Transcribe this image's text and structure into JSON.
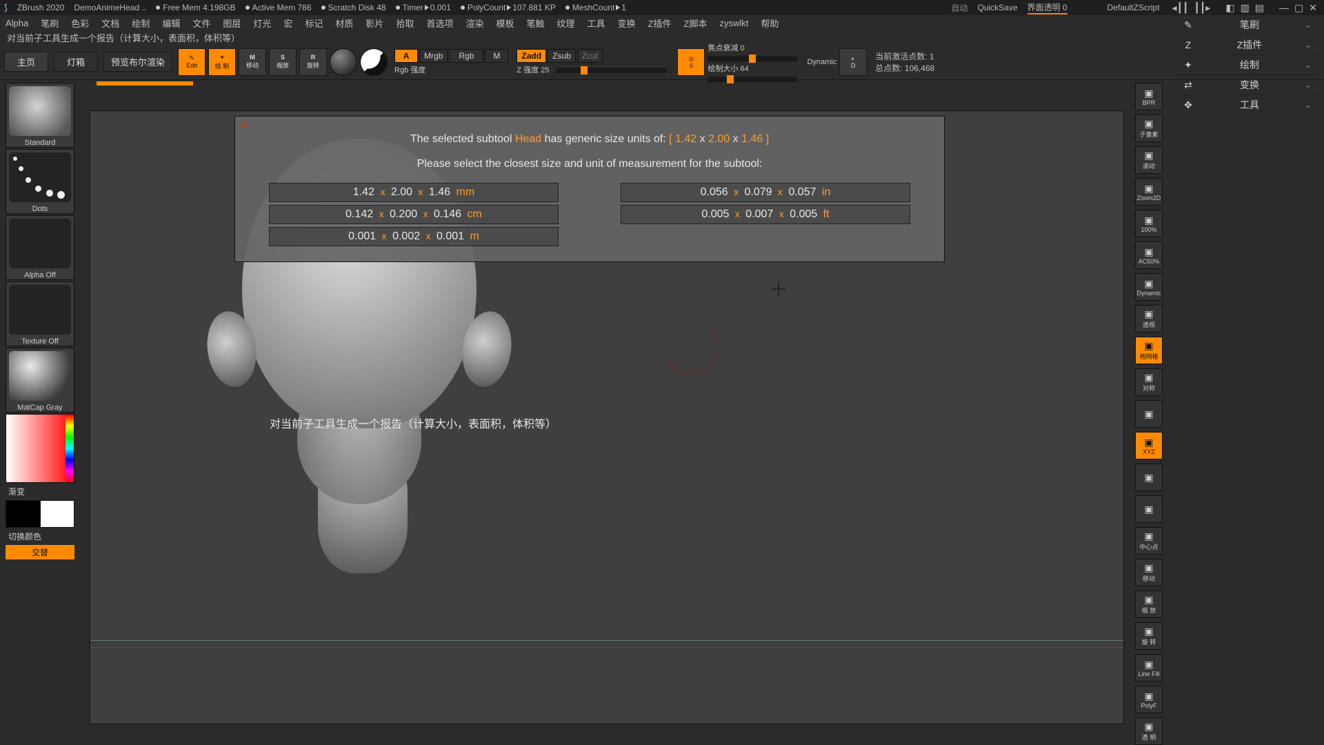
{
  "title": {
    "app": "ZBrush 2020",
    "document": "DemoAnimeHead  ..",
    "freeMem": "Free Mem 4.198GB",
    "activeMem": "Active Mem 786",
    "scratch": "Scratch Disk 48",
    "timer": "Timer",
    "timerVal": "0.001",
    "polyCount": "PolyCount",
    "polyVal": "107.881 KP",
    "meshCount": "MeshCount",
    "meshVal": "1",
    "auto": "自动",
    "quicksave": "QuickSave",
    "uiTrans": "界面透明 0",
    "zscript": "DefaultZScript"
  },
  "menu": [
    "Alpha",
    "笔刷",
    "色彩",
    "文档",
    "绘制",
    "编辑",
    "文件",
    "图层",
    "灯光",
    "宏",
    "标记",
    "材质",
    "影片",
    "拾取",
    "首选项",
    "渲染",
    "模板",
    "笔触",
    "纹理",
    "工具",
    "变换",
    "Z插件",
    "Z脚本",
    "zyswlkt",
    "帮助"
  ],
  "status": "对当前子工具生成一个报告（计算大小，表面积，体积等）",
  "shelf": {
    "home": "主页",
    "lightbox": "灯箱",
    "previewBPR": "预览布尔渲染",
    "edit": "Edit",
    "draw": "绘 制",
    "move": "移动",
    "scale": "缩放",
    "rotate": "旋转",
    "mrgbA": "A",
    "mrgb": "Mrgb",
    "rgb": "Rgb",
    "m": "M",
    "zadd": "Zadd",
    "zsub": "Zsub",
    "zcut": "Zcut",
    "rgbIntensity": "Rgb 强度",
    "zIntensity": "Z 强度  25",
    "focalShift": "焦点衰减  0",
    "drawSize": "绘制大小  64",
    "dynamic": "Dynamic",
    "activePoints": "当前激活点数: 1",
    "totalPoints": "总点数: 106,468"
  },
  "left": {
    "brush": "Standard",
    "stroke": "Dots",
    "alpha": "Alpha Off",
    "texture": "Texture Off",
    "material": "MatCap Gray",
    "gradient": "渐变",
    "switch": "切换颜色",
    "alt": "交替"
  },
  "rightShelf": [
    "BPR",
    "子像素",
    "滚动",
    "Zoom2D",
    "100%",
    "AC50%",
    "Dynamic",
    "透视",
    "地网格",
    "对称",
    "",
    "XYZ",
    "",
    "",
    "中心点",
    "移动",
    "缩 放",
    "旋 转",
    "Line Fill",
    "PolyF",
    "透 明"
  ],
  "rightPanels": [
    "笔刷",
    "Z插件",
    "绘制",
    "变换",
    "工具"
  ],
  "canvasHint": "对当前子工具生成一个报告（计算大小，表面积，体积等）",
  "dialog": {
    "line1_pre": "The selected subtool ",
    "line1_name": "Head",
    "line1_mid": " has generic size units of: ",
    "line1_dims": [
      "1.42",
      "2.00",
      "1.46"
    ],
    "line2": "Please select the closest size and unit of measurement for the subtool:",
    "left": [
      {
        "a": "1.42",
        "b": "2.00",
        "c": "1.46",
        "u": "mm"
      },
      {
        "a": "0.142",
        "b": "0.200",
        "c": "0.146",
        "u": "cm"
      },
      {
        "a": "0.001",
        "b": "0.002",
        "c": "0.001",
        "u": "m"
      }
    ],
    "right": [
      {
        "a": "0.056",
        "b": "0.079",
        "c": "0.057",
        "u": "in"
      },
      {
        "a": "0.005",
        "b": "0.007",
        "c": "0.005",
        "u": "ft"
      }
    ]
  }
}
